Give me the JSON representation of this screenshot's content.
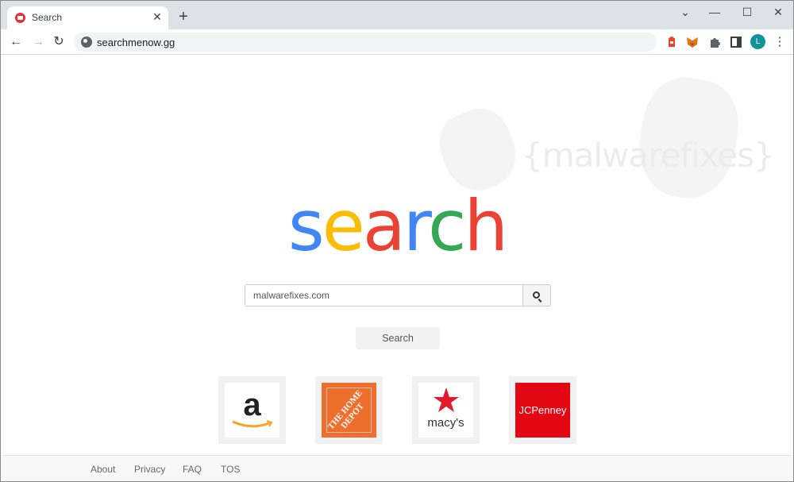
{
  "browser": {
    "tab": {
      "title": "Search",
      "close_glyph": "✕"
    },
    "new_tab_glyph": "+",
    "window_controls": {
      "tab_search": "⌄",
      "minimize": "—",
      "maximize": "☐",
      "close": "✕"
    },
    "nav": {
      "back": "←",
      "forward": "→",
      "reload": "↻"
    },
    "url": "searchmenow.gg",
    "extensions": [
      "bookmark-pin-icon",
      "metamask-fox-icon",
      "puzzle-extensions-icon",
      "side-panel-icon"
    ],
    "profile_initial": "L",
    "menu_glyph": "⋮"
  },
  "page": {
    "watermark": "{malwarefixes}",
    "logo": {
      "letters": [
        {
          "char": "s",
          "color": "#4285f4"
        },
        {
          "char": "e",
          "color": "#fbbc05"
        },
        {
          "char": "a",
          "color": "#ea4335"
        },
        {
          "char": "r",
          "color": "#4285f4"
        },
        {
          "char": "c",
          "color": "#34a853"
        },
        {
          "char": "h",
          "color": "#ea4335"
        }
      ]
    },
    "search": {
      "value": "malwarefixes.com",
      "placeholder": ""
    },
    "search_button": "Search",
    "tiles": [
      {
        "name": "Amazon",
        "label": "a"
      },
      {
        "name": "The Home Depot",
        "label": "THE HOME DEPOT"
      },
      {
        "name": "Macy's",
        "label": "macy's"
      },
      {
        "name": "JCPenney",
        "label": "JCPenney"
      }
    ],
    "footer_links": [
      "About",
      "Privacy",
      "FAQ",
      "TOS"
    ]
  }
}
